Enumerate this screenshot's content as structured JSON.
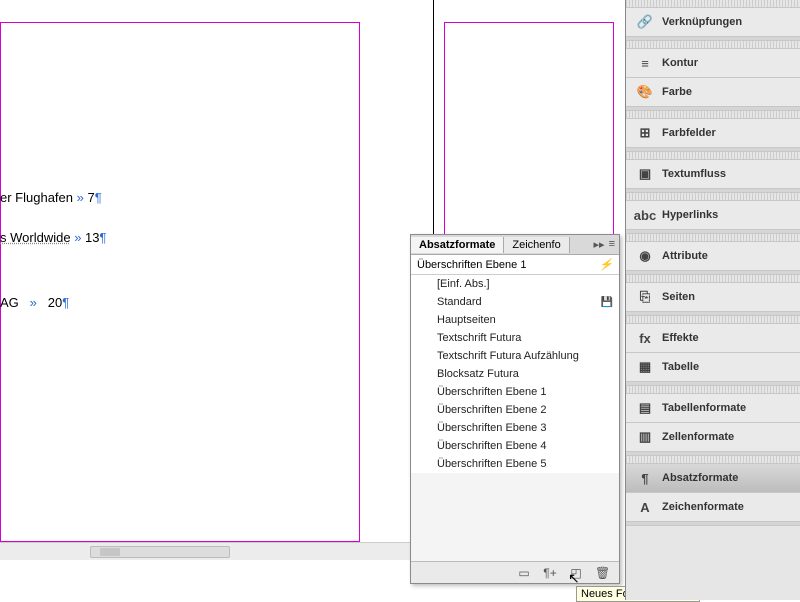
{
  "document": {
    "lines": [
      {
        "text": "er Flughafen",
        "sep": "»",
        "num": "7"
      },
      {
        "text": "s Worldwide",
        "sep": "»",
        "num": "13",
        "underline": true
      },
      {
        "text": "AG",
        "sep": "»",
        "num": "20"
      }
    ]
  },
  "panel": {
    "tabs": {
      "active": "Absatzformate",
      "other": "Zeichenfo"
    },
    "collapse_glyph": "▸▸",
    "menu_glyph": "≡",
    "header": "Überschriften Ebene 1",
    "flash": "⚡",
    "styles": [
      {
        "label": "[Einf. Abs.]"
      },
      {
        "label": "Standard",
        "disk": true
      },
      {
        "label": "Hauptseiten"
      },
      {
        "label": "Textschrift Futura"
      },
      {
        "label": "Textschrift Futura Aufzählung"
      },
      {
        "label": "Blocksatz Futura"
      },
      {
        "label": "Überschriften Ebene 1"
      },
      {
        "label": "Überschriften Ebene 2"
      },
      {
        "label": "Überschriften Ebene 3"
      },
      {
        "label": "Überschriften Ebene 4"
      },
      {
        "label": "Überschriften Ebene 5"
      }
    ],
    "footer_icons": {
      "folder": "▭",
      "para": "¶+",
      "new": "◰",
      "trash": "🗑"
    },
    "tooltip": "Neues Format erstellen"
  },
  "sidebar": {
    "items": [
      {
        "icon": "🔗",
        "label": "Verknüpfungen"
      },
      {
        "icon": "≡",
        "label": "Kontur"
      },
      {
        "icon": "🎨",
        "label": "Farbe"
      },
      {
        "icon": "⊞",
        "label": "Farbfelder"
      },
      {
        "icon": "▣",
        "label": "Textumfluss"
      },
      {
        "icon": "abc",
        "label": "Hyperlinks"
      },
      {
        "icon": "◉",
        "label": "Attribute"
      },
      {
        "icon": "⎘",
        "label": "Seiten"
      },
      {
        "icon": "fx",
        "label": "Effekte"
      },
      {
        "icon": "▦",
        "label": "Tabelle"
      },
      {
        "icon": "▤",
        "label": "Tabellenformate"
      },
      {
        "icon": "▥",
        "label": "Zellenformate"
      },
      {
        "icon": "¶",
        "label": "Absatzformate",
        "active": true
      },
      {
        "icon": "A",
        "label": "Zeichenformate"
      }
    ]
  }
}
